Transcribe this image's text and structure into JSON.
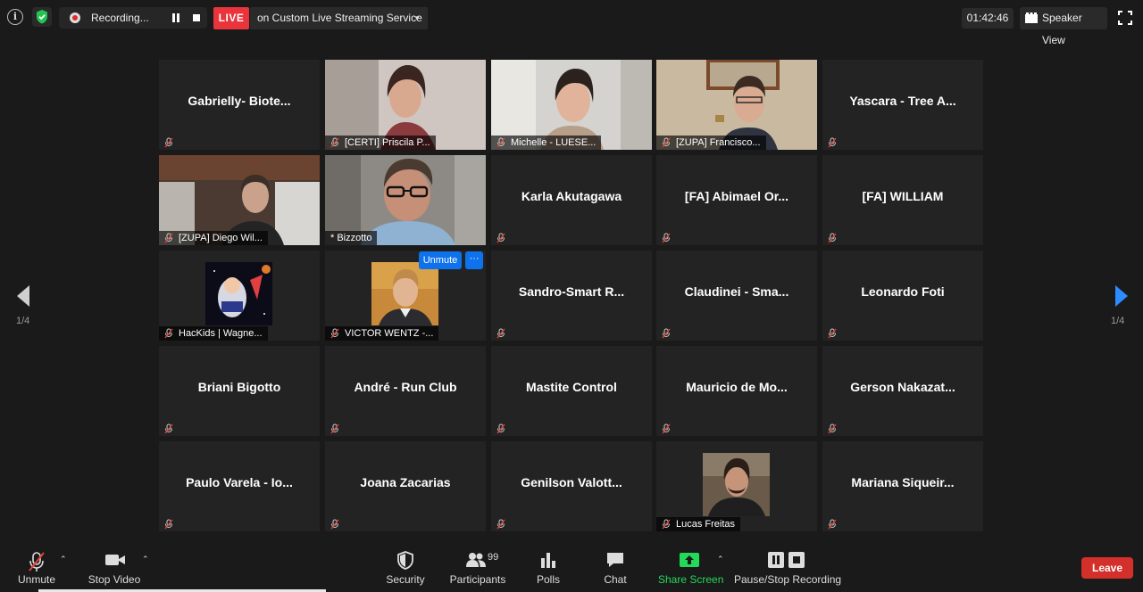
{
  "topbar": {
    "recording_label": "Recording...",
    "live_label": "LIVE",
    "stream_label": "on Custom Live Streaming Service",
    "timer": "01:42:46",
    "view_label": "Speaker View"
  },
  "pager": {
    "left_label": "1/4",
    "right_label": "1/4"
  },
  "tiles": [
    {
      "name": "Gabrielly-  Biote...",
      "footer": ""
    },
    {
      "name": "",
      "footer": "[CERTI] Priscila P..."
    },
    {
      "name": "",
      "footer": "Michelle - LUESE..."
    },
    {
      "name": "",
      "footer": "[ZUPA] Francisco..."
    },
    {
      "name": "Yascara - Tree A...",
      "footer": ""
    },
    {
      "name": "",
      "footer": "[ZUPA] Diego Wil..."
    },
    {
      "name": "",
      "footer": "* Bizzotto"
    },
    {
      "name": "Karla Akutagawa",
      "footer": ""
    },
    {
      "name": "[FA]  Abimael Or...",
      "footer": ""
    },
    {
      "name": "[FA] WILLIAM",
      "footer": ""
    },
    {
      "name": "",
      "footer": "HacKids | Wagne..."
    },
    {
      "name": "",
      "footer": "VICTOR WENTZ -..."
    },
    {
      "name": "Sandro-Smart  R...",
      "footer": ""
    },
    {
      "name": "Claudinei  - Sma...",
      "footer": ""
    },
    {
      "name": "Leonardo Foti",
      "footer": ""
    },
    {
      "name": "Briani Bigotto",
      "footer": ""
    },
    {
      "name": "André - Run Club",
      "footer": ""
    },
    {
      "name": "Mastite Control",
      "footer": ""
    },
    {
      "name": "Mauricio  de  Mo...",
      "footer": ""
    },
    {
      "name": "Gerson  Nakazat...",
      "footer": ""
    },
    {
      "name": "Paulo Varela - Io...",
      "footer": ""
    },
    {
      "name": "Joana Zacarias",
      "footer": ""
    },
    {
      "name": "Genilson  Valott...",
      "footer": ""
    },
    {
      "name": "",
      "footer": "Lucas Freitas"
    },
    {
      "name": "Mariana  Siqueir...",
      "footer": ""
    }
  ],
  "hover": {
    "unmute_label": "Unmute",
    "more_label": "···"
  },
  "bottombar": {
    "unmute": "Unmute",
    "stop_video": "Stop Video",
    "security": "Security",
    "participants": "Participants",
    "participant_count": "99",
    "polls": "Polls",
    "chat": "Chat",
    "share_screen": "Share Screen",
    "pause_stop_recording": "Pause/Stop Recording",
    "leave": "Leave"
  },
  "colors": {
    "live_red": "#e8343a",
    "leave_red": "#d3302b",
    "share_green": "#23d959",
    "accent_blue": "#0e72ed",
    "active_speaker": "#c6e07a"
  }
}
